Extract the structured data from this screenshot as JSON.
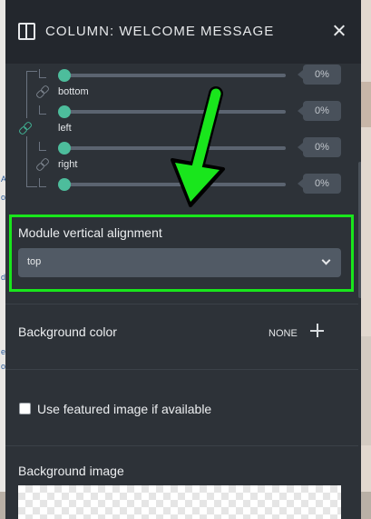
{
  "header": {
    "title": "COLUMN: WELCOME MESSAGE"
  },
  "padding": {
    "rows": [
      {
        "value_label": "0%"
      },
      {
        "label": "bottom",
        "value_label": "0%"
      },
      {
        "label": "left",
        "value_label": "0%"
      },
      {
        "label": "right",
        "value_label": "0%"
      }
    ]
  },
  "alignment": {
    "label": "Module vertical alignment",
    "selected": "top"
  },
  "background_color": {
    "label": "Background color",
    "value": "NONE"
  },
  "featured_image": {
    "label": "Use featured image if available",
    "checked": false
  },
  "background_image": {
    "label": "Background image"
  },
  "colors": {
    "panel": "#2d3238",
    "header": "#23272d",
    "slider_accent": "#4dbd9c",
    "highlight": "#19e61c"
  }
}
